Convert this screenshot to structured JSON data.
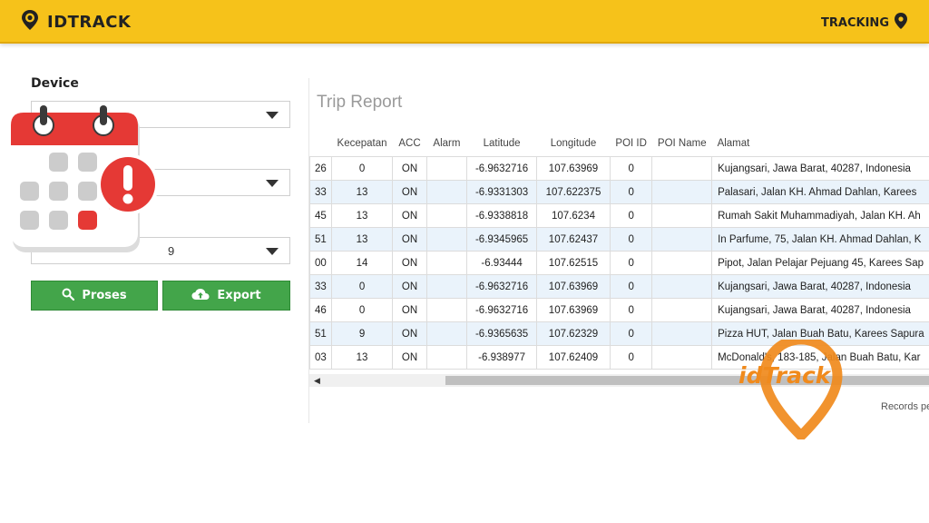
{
  "header": {
    "brand": "IDTRACK",
    "tracking_label": "TRACKING"
  },
  "filters": {
    "device_label": "Device",
    "select_1_value": "",
    "select_2_value": "",
    "select_3_value": "9"
  },
  "buttons": {
    "proses": "Proses",
    "export": "Export"
  },
  "report": {
    "title": "Trip Report",
    "columns": [
      "",
      "Kecepatan",
      "ACC",
      "Alarm",
      "Latitude",
      "Longitude",
      "POI ID",
      "POI Name",
      "Alamat"
    ],
    "rows": [
      [
        "26",
        "0",
        "ON",
        "",
        "-6.9632716",
        "107.63969",
        "0",
        "",
        "Kujangsari, Jawa Barat, 40287, Indonesia"
      ],
      [
        "33",
        "13",
        "ON",
        "",
        "-6.9331303",
        "107.622375",
        "0",
        "",
        "Palasari, Jalan KH. Ahmad Dahlan, Karees"
      ],
      [
        "45",
        "13",
        "ON",
        "",
        "-6.9338818",
        "107.6234",
        "0",
        "",
        "Rumah Sakit Muhammadiyah, Jalan KH. Ah"
      ],
      [
        "51",
        "13",
        "ON",
        "",
        "-6.9345965",
        "107.62437",
        "0",
        "",
        "In Parfume, 75, Jalan KH. Ahmad Dahlan, K"
      ],
      [
        "00",
        "14",
        "ON",
        "",
        "-6.93444",
        "107.62515",
        "0",
        "",
        "Pipot, Jalan Pelajar Pejuang 45, Karees Sap"
      ],
      [
        "33",
        "0",
        "ON",
        "",
        "-6.9632716",
        "107.63969",
        "0",
        "",
        "Kujangsari, Jawa Barat, 40287, Indonesia"
      ],
      [
        "46",
        "0",
        "ON",
        "",
        "-6.9632716",
        "107.63969",
        "0",
        "",
        "Kujangsari, Jawa Barat, 40287, Indonesia"
      ],
      [
        "51",
        "9",
        "ON",
        "",
        "-6.9365635",
        "107.62329",
        "0",
        "",
        "Pizza HUT, Jalan Buah Batu, Karees Sapura"
      ],
      [
        "03",
        "13",
        "ON",
        "",
        "-6.938977",
        "107.62409",
        "0",
        "",
        "McDonald's, 183-185, Jalan Buah Batu, Kar"
      ]
    ],
    "records_label": "Records pe"
  },
  "watermark": {
    "text": "idTrack"
  },
  "colors": {
    "topbar": "#f6c21a",
    "button_green": "#43a54a",
    "row_alt": "#eaf3fb",
    "calendar_red": "#e53935",
    "watermark_orange": "#f08a1c"
  },
  "icons": {
    "brand": "location-pin-icon",
    "tracking": "location-pin-icon",
    "proses": "search-icon",
    "export": "cloud-upload-icon",
    "calendar": "calendar-alert-icon"
  }
}
